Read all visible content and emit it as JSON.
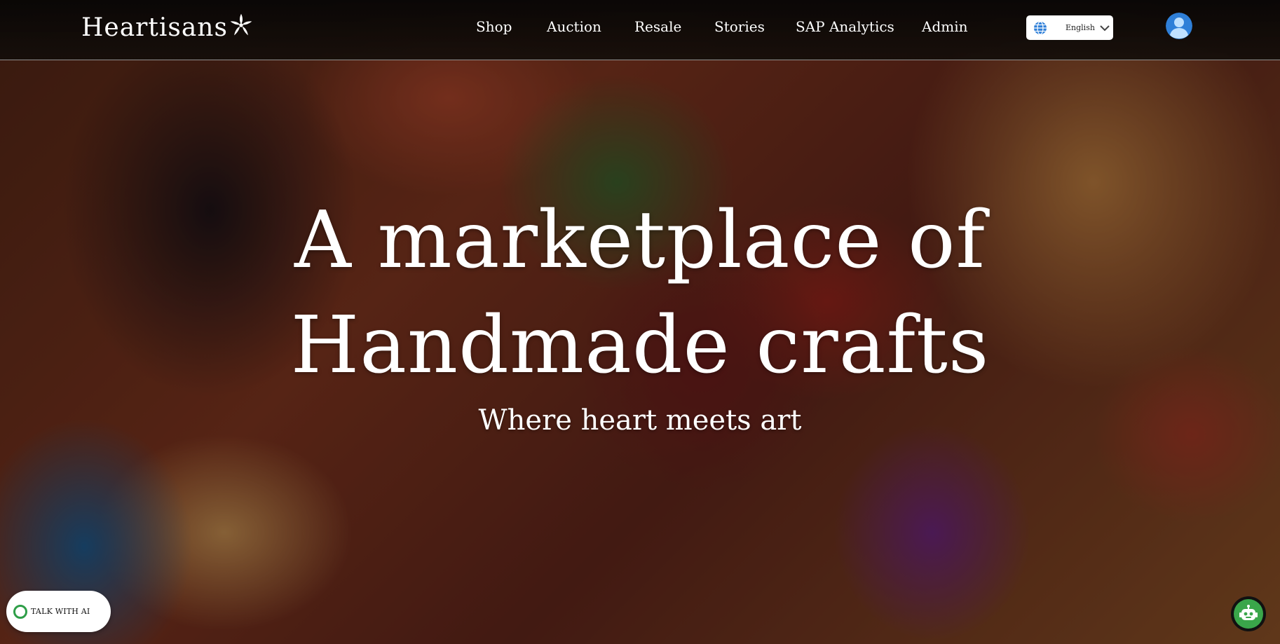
{
  "brand": {
    "name": "Heartisans",
    "icon": "flower-star-icon"
  },
  "nav": {
    "items": [
      {
        "label": "Shop"
      },
      {
        "label": "Auction"
      },
      {
        "label": "Resale"
      },
      {
        "label": "Stories"
      },
      {
        "label": "SAP Analytics"
      },
      {
        "label": "Admin"
      }
    ]
  },
  "language": {
    "selected": "English",
    "icon": "globe-icon"
  },
  "user": {
    "icon": "user-avatar-icon"
  },
  "hero": {
    "title_line1": "A marketplace of",
    "title_line2": "Handmade crafts",
    "subtitle": "Where heart meets art"
  },
  "assistant": {
    "talk_label": "TALK WITH AI",
    "bot_icon": "robot-icon"
  },
  "colors": {
    "nav_bg": "#0a0705",
    "text": "#ffffff",
    "accent_green": "#3aa64a",
    "avatar_blue": "#2f7fd8"
  }
}
